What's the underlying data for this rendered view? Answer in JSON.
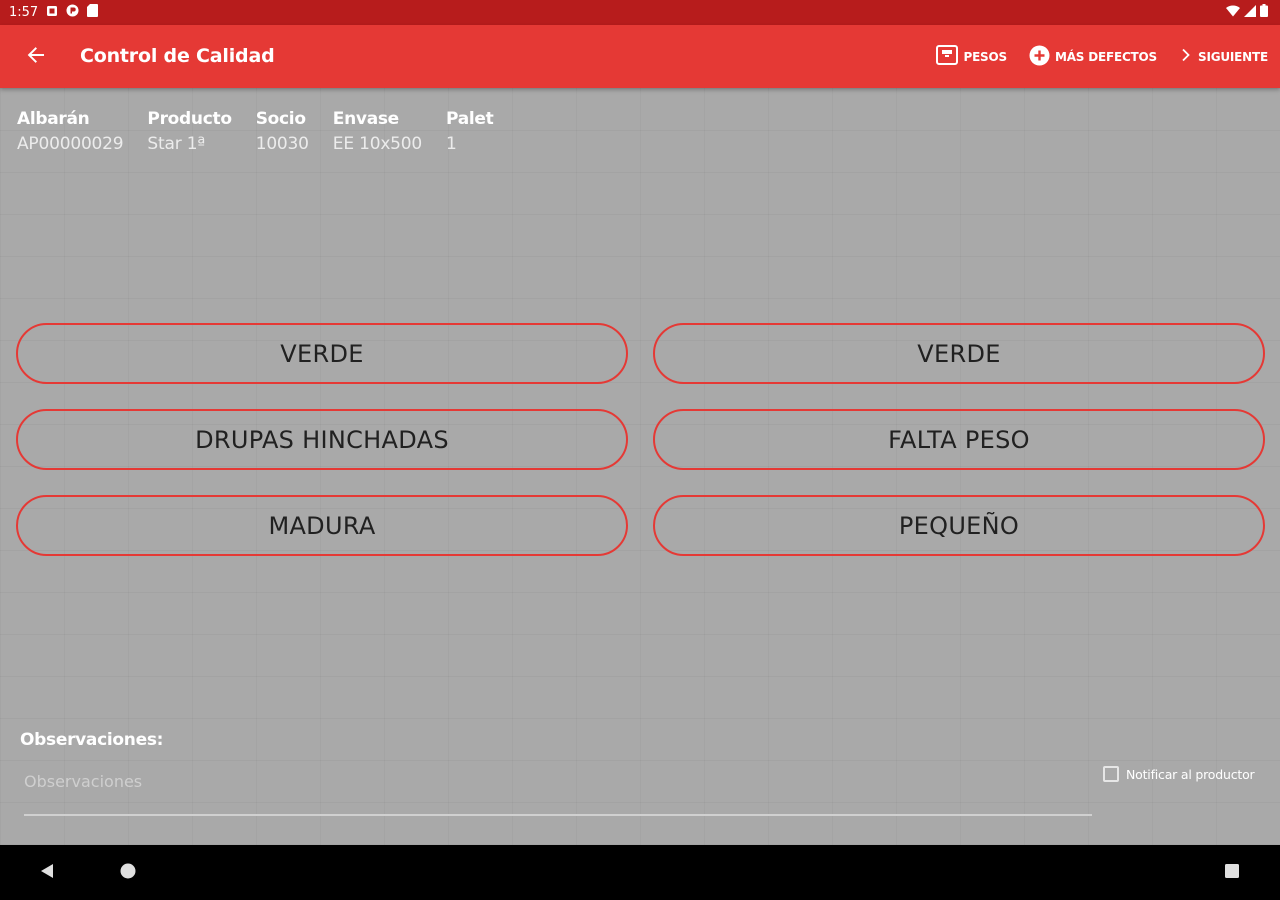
{
  "status_bar": {
    "time": "1:57"
  },
  "app_bar": {
    "title": "Control de Calidad",
    "actions": {
      "pesos": "PESOS",
      "mas_defectos": "MÁS DEFECTOS",
      "siguiente": "SIGUIENTE"
    }
  },
  "info": {
    "albaran": {
      "label": "Albarán",
      "value": "AP00000029"
    },
    "producto": {
      "label": "Producto",
      "value": "Star 1ª"
    },
    "socio": {
      "label": "Socio",
      "value": "10030"
    },
    "envase": {
      "label": "Envase",
      "value": "EE 10x500"
    },
    "palet": {
      "label": "Palet",
      "value": "1"
    }
  },
  "defects": [
    "VERDE",
    "VERDE",
    "DRUPAS HINCHADAS",
    "FALTA PESO",
    "MADURA",
    "PEQUEÑO"
  ],
  "observations": {
    "label": "Observaciones:",
    "placeholder": "Observaciones",
    "value": ""
  },
  "notify": {
    "label": "Notificar al productor",
    "checked": false
  },
  "colors": {
    "status_bar": "#b71c1c",
    "app_bar": "#e53935",
    "accent": "#e53935",
    "background": "#a9a9a9"
  }
}
